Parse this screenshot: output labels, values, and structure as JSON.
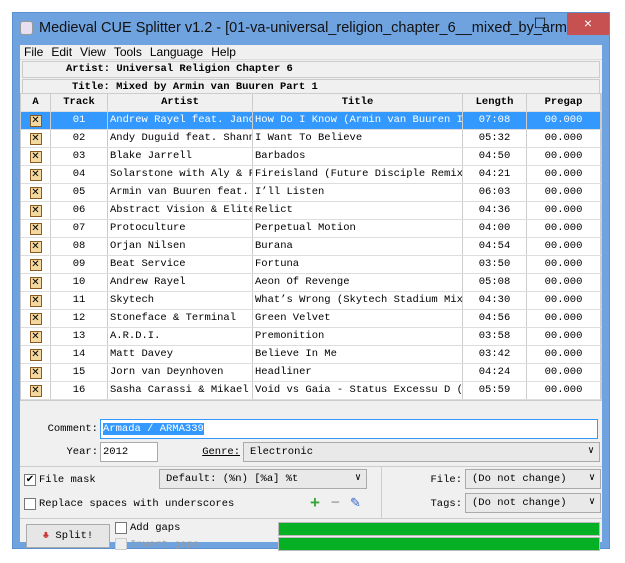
{
  "window": {
    "title": "Medieval CUE Splitter v1.2 - [01-va-universal_religion_chapter_6__mixed_by_armin_...",
    "minimize": "-",
    "maximize": "☐",
    "close": "×"
  },
  "menu": [
    "File",
    "Edit",
    "View",
    "Tools",
    "Language",
    "Help"
  ],
  "album": {
    "artist_label": "Artist:",
    "artist": "Universal Religion Chapter 6",
    "title_label": "Title:",
    "title": "Mixed by Armin van Buuren Part 1"
  },
  "table": {
    "headers": [
      "A",
      "Track",
      "Artist",
      "Title",
      "Length",
      "Pregap"
    ],
    "rows": [
      {
        "track": "01",
        "artist": "Andrew Rayel feat. Jano",
        "title": "How Do I Know (Armin van Buuren In",
        "length": "07:08",
        "pregap": "00.000"
      },
      {
        "track": "02",
        "artist": "Andy Duguid feat. Shanno",
        "title": "I Want To Believe",
        "length": "05:32",
        "pregap": "00.000"
      },
      {
        "track": "03",
        "artist": "Blake Jarrell",
        "title": "Barbados",
        "length": "04:50",
        "pregap": "00.000"
      },
      {
        "track": "04",
        "artist": "Solarstone with Aly & Fi",
        "title": "Fireisland (Future Disciple Remix)",
        "length": "04:21",
        "pregap": "00.000"
      },
      {
        "track": "05",
        "artist": "Armin van Buuren feat. A",
        "title": "I’ll Listen",
        "length": "06:03",
        "pregap": "00.000"
      },
      {
        "track": "06",
        "artist": "Abstract Vision & Elite",
        "title": "Relict",
        "length": "04:36",
        "pregap": "00.000"
      },
      {
        "track": "07",
        "artist": "Protoculture",
        "title": "Perpetual Motion",
        "length": "04:00",
        "pregap": "00.000"
      },
      {
        "track": "08",
        "artist": "Orjan Nilsen",
        "title": "Burana",
        "length": "04:54",
        "pregap": "00.000"
      },
      {
        "track": "09",
        "artist": "Beat Service",
        "title": "Fortuna",
        "length": "03:50",
        "pregap": "00.000"
      },
      {
        "track": "10",
        "artist": "Andrew Rayel",
        "title": "Aeon Of Revenge",
        "length": "05:08",
        "pregap": "00.000"
      },
      {
        "track": "11",
        "artist": "Skytech",
        "title": "What’s Wrong (Skytech Stadium Mix)",
        "length": "04:30",
        "pregap": "00.000"
      },
      {
        "track": "12",
        "artist": "Stoneface & Terminal",
        "title": "Green Velvet",
        "length": "04:56",
        "pregap": "00.000"
      },
      {
        "track": "13",
        "artist": "A.R.D.I.",
        "title": "Premonition",
        "length": "03:58",
        "pregap": "00.000"
      },
      {
        "track": "14",
        "artist": "Matt Davey",
        "title": "Believe In Me",
        "length": "03:42",
        "pregap": "00.000"
      },
      {
        "track": "15",
        "artist": "Jorn van Deynhoven",
        "title": "Headliner",
        "length": "04:24",
        "pregap": "00.000"
      },
      {
        "track": "16",
        "artist": "Sasha Carassi & Mikael J",
        "title": "Void vs Gaia - Status Excessu D (A",
        "length": "05:59",
        "pregap": "00.000"
      }
    ]
  },
  "tags": {
    "comment_label": "Comment:",
    "comment": "Armada / ARMA339",
    "year_label": "Year:",
    "year": "2012",
    "genre_label": "Genre:",
    "genre": "Electronic"
  },
  "options": {
    "file_mask_label": "File mask",
    "file_mask": "Default: (%n) [%a] %t",
    "replace_label": "Replace spaces with underscores",
    "file_label": "File:",
    "file_value": "(Do not change)",
    "tags_label": "Tags:",
    "tags_value": "(Do not change)"
  },
  "bottom": {
    "split": "Split!",
    "add_gaps": "Add gaps",
    "invert_gaps": "Invert gaps",
    "progress1": 100,
    "progress2": 100
  },
  "colors": {
    "selection": "#3399ff",
    "progress": "#06b025",
    "frame": "#6fa3e0",
    "close": "#c75050"
  }
}
